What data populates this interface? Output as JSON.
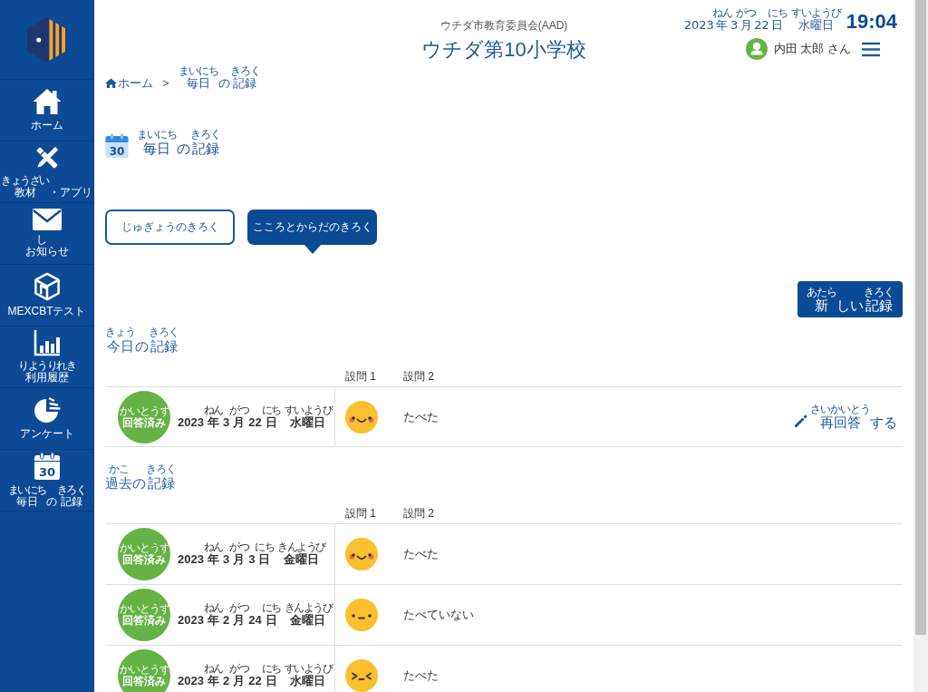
{
  "sidebar": {
    "items": [
      {
        "label": [
          {
            "text": "ホーム"
          }
        ]
      },
      {
        "label": [
          {
            "text": "教材",
            "ruby": "きょうざい"
          },
          {
            "text": "・アプリ"
          }
        ]
      },
      {
        "label": [
          {
            "text": "お"
          },
          {
            "text": "知",
            "ruby": "し"
          },
          {
            "text": "らせ"
          }
        ]
      },
      {
        "label": [
          {
            "text": "MEXCBTテスト"
          }
        ]
      },
      {
        "label": [
          {
            "text": "利用履歴",
            "ruby": "りようりれき"
          }
        ]
      },
      {
        "label": [
          {
            "text": "アンケート"
          }
        ]
      },
      {
        "label": [
          {
            "text": "毎日",
            "ruby": "まいにち"
          },
          {
            "text": "の"
          },
          {
            "text": "記録",
            "ruby": "きろく"
          }
        ],
        "icon_text": "30"
      }
    ]
  },
  "header": {
    "organization": "ウチダ市教育委員会(AAD)",
    "school": "ウチダ第10小学校",
    "date": [
      {
        "text": "2023"
      },
      {
        "text": "年",
        "ruby": "ねん"
      },
      {
        "text": "3"
      },
      {
        "text": "月",
        "ruby": "がつ"
      },
      {
        "text": "22"
      },
      {
        "text": "日",
        "ruby": "にち"
      }
    ],
    "weekday": [
      {
        "text": "水曜日",
        "ruby": "すいようび"
      }
    ],
    "time": "19:04",
    "user": "内田 太郎 さん"
  },
  "breadcrumb": {
    "items": [
      [
        {
          "text": "ホーム"
        }
      ],
      [
        {
          "text": "毎日",
          "ruby": "まいにち"
        },
        {
          "text": "の"
        },
        {
          "text": "記録",
          "ruby": "きろく"
        }
      ]
    ],
    "separator": ">"
  },
  "page_title": {
    "icon_text": "30",
    "label": [
      {
        "text": "毎日",
        "ruby": "まいにち"
      },
      {
        "text": "の"
      },
      {
        "text": "記録",
        "ruby": "きろく"
      }
    ]
  },
  "tabs": [
    {
      "label": "じゅぎょうのきろく",
      "selected": false
    },
    {
      "label": "こころとからだのきろく",
      "selected": true
    }
  ],
  "new_record_button": [
    {
      "text": "新",
      "ruby": "あたら"
    },
    {
      "text": "しい"
    },
    {
      "text": "記録",
      "ruby": "きろく"
    }
  ],
  "sections": [
    {
      "title": [
        {
          "text": "今日",
          "ruby": "きょう"
        },
        {
          "text": "の"
        },
        {
          "text": "記録",
          "ruby": "きろく"
        }
      ],
      "columns": [
        "設問 1",
        "設問 2"
      ],
      "rows": [
        {
          "status": [
            {
              "text": "回答済み",
              "ruby": "かいとうず"
            }
          ],
          "date": [
            {
              "text": "2023"
            },
            {
              "text": "年",
              "ruby": "ねん"
            },
            {
              "text": "3"
            },
            {
              "text": "月",
              "ruby": "がつ"
            },
            {
              "text": "22"
            },
            {
              "text": "日",
              "ruby": "にち"
            }
          ],
          "weekday": [
            {
              "text": "水曜日",
              "ruby": "すいようび"
            }
          ],
          "answers": [
            {
              "kind": "happy"
            },
            {
              "kind": "text",
              "text": "たべた"
            }
          ],
          "action": [
            {
              "text": "再回答",
              "ruby": "さいかいとう"
            },
            {
              "text": "する"
            }
          ]
        }
      ]
    },
    {
      "title": [
        {
          "text": "過去",
          "ruby": "かこ"
        },
        {
          "text": "の"
        },
        {
          "text": "記録",
          "ruby": "きろく"
        }
      ],
      "columns": [
        "設問 1",
        "設問 2"
      ],
      "rows": [
        {
          "status": [
            {
              "text": "回答済み",
              "ruby": "かいとうず"
            }
          ],
          "date": [
            {
              "text": "2023"
            },
            {
              "text": "年",
              "ruby": "ねん"
            },
            {
              "text": "3"
            },
            {
              "text": "月",
              "ruby": "がつ"
            },
            {
              "text": "3"
            },
            {
              "text": "日",
              "ruby": "にち"
            }
          ],
          "weekday": [
            {
              "text": "金曜日",
              "ruby": "きんようび"
            }
          ],
          "answers": [
            {
              "kind": "happy"
            },
            {
              "kind": "text",
              "text": "たべた"
            }
          ]
        },
        {
          "status": [
            {
              "text": "回答済み",
              "ruby": "かいとうず"
            }
          ],
          "date": [
            {
              "text": "2023"
            },
            {
              "text": "年",
              "ruby": "ねん"
            },
            {
              "text": "2"
            },
            {
              "text": "月",
              "ruby": "がつ"
            },
            {
              "text": "24"
            },
            {
              "text": "日",
              "ruby": "にち"
            }
          ],
          "weekday": [
            {
              "text": "金曜日",
              "ruby": "きんようび"
            }
          ],
          "answers": [
            {
              "kind": "neutral"
            },
            {
              "kind": "text",
              "text": "たべていない"
            }
          ]
        },
        {
          "status": [
            {
              "text": "回答済み",
              "ruby": "かいとうず"
            }
          ],
          "date": [
            {
              "text": "2023"
            },
            {
              "text": "年",
              "ruby": "ねん"
            },
            {
              "text": "2"
            },
            {
              "text": "月",
              "ruby": "がつ"
            },
            {
              "text": "22"
            },
            {
              "text": "日",
              "ruby": "にち"
            }
          ],
          "weekday": [
            {
              "text": "水曜日",
              "ruby": "すいようび"
            }
          ],
          "answers": [
            {
              "kind": "squint"
            },
            {
              "kind": "text",
              "text": "たべた"
            }
          ]
        }
      ]
    }
  ]
}
